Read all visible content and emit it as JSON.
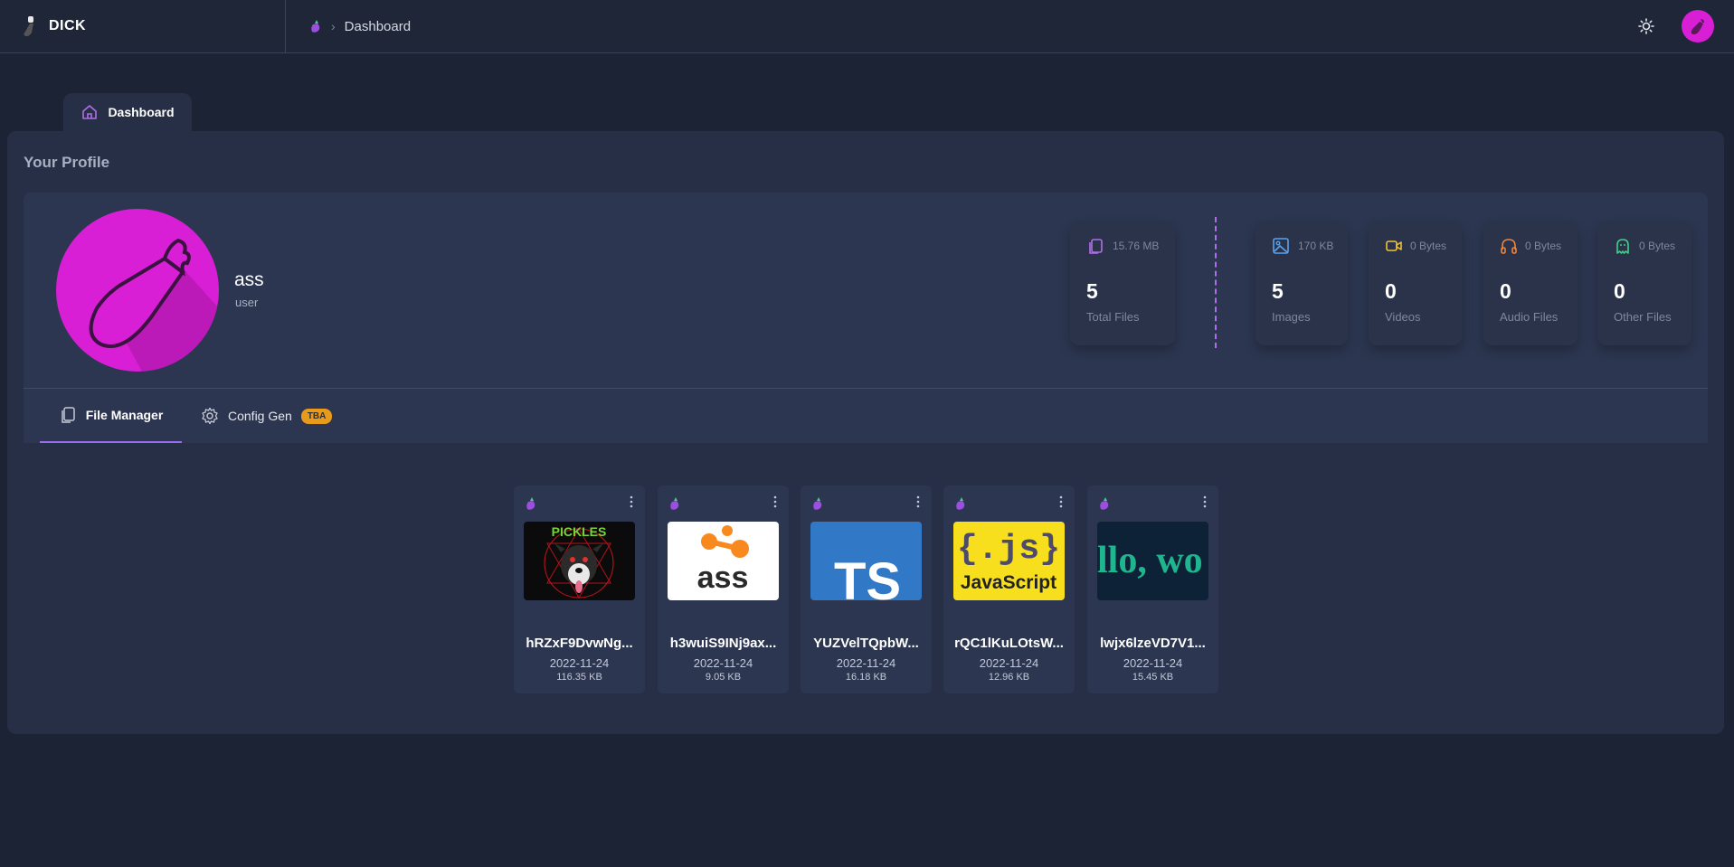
{
  "brand": {
    "name": "DICK"
  },
  "breadcrumb": {
    "current": "Dashboard"
  },
  "tab": {
    "label": "Dashboard"
  },
  "profile": {
    "section_title": "Your Profile",
    "username": "ass",
    "role": "user"
  },
  "stats": [
    {
      "size": "15.76 MB",
      "count": "5",
      "label": "Total Files",
      "icon": "files-icon",
      "color": "#b06ee8"
    },
    {
      "size": "170 KB",
      "count": "5",
      "label": "Images",
      "icon": "image-icon",
      "color": "#5aa2f0"
    },
    {
      "size": "0 Bytes",
      "count": "0",
      "label": "Videos",
      "icon": "video-icon",
      "color": "#f2c232"
    },
    {
      "size": "0 Bytes",
      "count": "0",
      "label": "Audio Files",
      "icon": "headphones-icon",
      "color": "#f2853a"
    },
    {
      "size": "0 Bytes",
      "count": "0",
      "label": "Other Files",
      "icon": "ghost-icon",
      "color": "#3fd08a"
    }
  ],
  "tabs": {
    "file_manager": "File Manager",
    "config_gen": "Config Gen",
    "config_gen_badge": "TBA"
  },
  "files": [
    {
      "name": "hRZxF9DvwNg...",
      "date": "2022-11-24",
      "size": "116.35 KB",
      "thumb": "dog-art"
    },
    {
      "name": "h3wuiS9INj9ax...",
      "date": "2022-11-24",
      "size": "9.05 KB",
      "thumb": "ass-logo"
    },
    {
      "name": "YUZVelTQpbW...",
      "date": "2022-11-24",
      "size": "16.18 KB",
      "thumb": "ts-logo"
    },
    {
      "name": "rQC1lKuLOtsW...",
      "date": "2022-11-24",
      "size": "12.96 KB",
      "thumb": "js-logo"
    },
    {
      "name": "lwjx6lzeVD7V1...",
      "date": "2022-11-24",
      "size": "15.45 KB",
      "thumb": "code-snippet"
    }
  ],
  "thumb_text": {
    "ts": "TS",
    "js_braces": "{.js}",
    "js_word": "JavaScript",
    "ass": "ass",
    "code": "llo, wo"
  },
  "colors": {
    "accent": "#9b6cf0",
    "avatar": "#d91fd6",
    "badge": "#e89a1a"
  }
}
